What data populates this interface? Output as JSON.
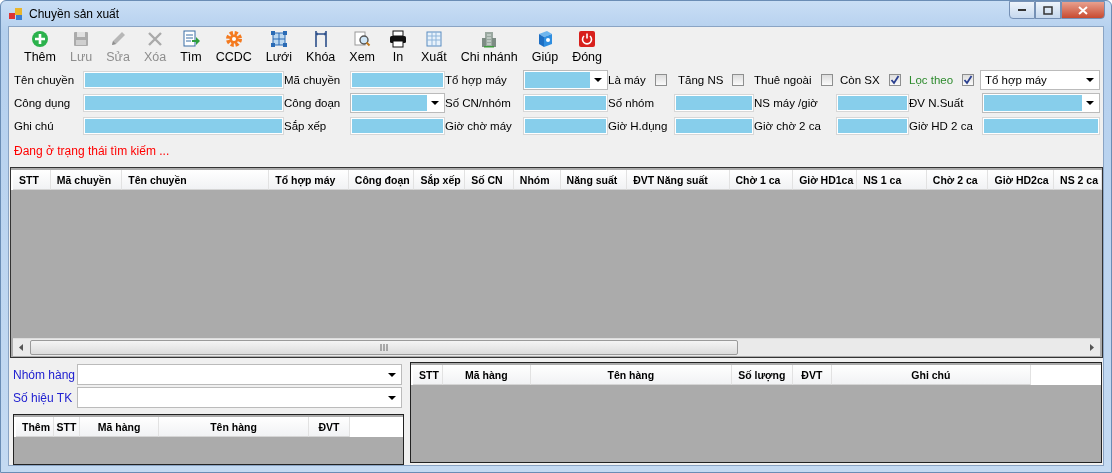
{
  "window": {
    "title": "Chuyền sản xuất"
  },
  "toolbar": [
    {
      "label": "Thêm",
      "disabled": false
    },
    {
      "label": "Lưu",
      "disabled": true
    },
    {
      "label": "Sửa",
      "disabled": true
    },
    {
      "label": "Xóa",
      "disabled": true
    },
    {
      "label": "Tìm",
      "disabled": false
    },
    {
      "label": "CCDC",
      "disabled": false
    },
    {
      "label": "Lưới",
      "disabled": false
    },
    {
      "label": "Khóa",
      "disabled": false
    },
    {
      "label": "Xem",
      "disabled": false
    },
    {
      "label": "In",
      "disabled": false
    },
    {
      "label": "Xuất",
      "disabled": false
    },
    {
      "label": "Chi nhánh",
      "disabled": false
    },
    {
      "label": "Giúp",
      "disabled": false
    },
    {
      "label": "Đóng",
      "disabled": false
    }
  ],
  "form": {
    "rows": [
      [
        {
          "kind": "label",
          "text": "Tên chuyền"
        },
        {
          "kind": "text"
        },
        {
          "kind": "label",
          "text": "Mã chuyền"
        },
        {
          "kind": "text"
        },
        {
          "kind": "label",
          "text": "Tổ hợp máy"
        },
        {
          "kind": "combo"
        },
        {
          "kind": "checkbox",
          "label": "Là máy",
          "checked": false
        },
        {
          "kind": "checkbox",
          "label": "Tăng NS",
          "checked": false
        },
        {
          "kind": "checkbox",
          "label": "Thuê ngoài",
          "checked": false
        },
        {
          "kind": "checkbox",
          "label": "Còn SX",
          "checked": true
        },
        {
          "kind": "filter-checkbox",
          "label": "Lọc theo",
          "checked": true
        },
        {
          "kind": "combo",
          "value": "Tổ hợp máy"
        }
      ],
      [
        {
          "kind": "label",
          "text": "Công dụng"
        },
        {
          "kind": "text"
        },
        {
          "kind": "label",
          "text": "Công đoạn"
        },
        {
          "kind": "combo"
        },
        {
          "kind": "label",
          "text": "Số CN/nhóm"
        },
        {
          "kind": "text"
        },
        {
          "kind": "label",
          "text": "Số nhóm"
        },
        {
          "kind": "text"
        },
        {
          "kind": "label",
          "text": "NS máy /giờ"
        },
        {
          "kind": "text"
        },
        {
          "kind": "label",
          "text": "ĐV N.Suất"
        },
        {
          "kind": "combo"
        }
      ],
      [
        {
          "kind": "label",
          "text": "Ghi chú"
        },
        {
          "kind": "text"
        },
        {
          "kind": "label",
          "text": "Sắp xếp"
        },
        {
          "kind": "text"
        },
        {
          "kind": "label",
          "text": "Giờ chờ máy"
        },
        {
          "kind": "text"
        },
        {
          "kind": "label",
          "text": "Giờ H.dụng"
        },
        {
          "kind": "text"
        },
        {
          "kind": "label",
          "text": "Giờ chờ 2 ca"
        },
        {
          "kind": "text"
        },
        {
          "kind": "label",
          "text": "Giờ HD 2 ca"
        },
        {
          "kind": "text"
        }
      ]
    ]
  },
  "status": "Đang ở trạng thái tìm kiếm ...",
  "main_table": {
    "columns": [
      "STT",
      "Mã chuyền",
      "Tên chuyền",
      "Tổ hợp máy",
      "Công đoạn",
      "Sắp xếp",
      "Số CN",
      "Nhóm",
      "Năng suất",
      "ĐVT Năng suất",
      "Chờ 1 ca",
      "Giờ HD1ca",
      "NS 1 ca",
      "Chờ 2 ca",
      "Giờ HD2ca",
      "NS 2 ca"
    ]
  },
  "item_filter": {
    "fields": [
      {
        "label": "Nhóm hàng"
      },
      {
        "label": "Số hiệu TK"
      }
    ],
    "table": {
      "columns": [
        "Thêm",
        "STT",
        "Mã hàng",
        "Tên hàng",
        "ĐVT"
      ]
    }
  },
  "items_table": {
    "columns": [
      "STT",
      "Mã hàng",
      "Tên hàng",
      "Số lượng",
      "ĐVT",
      "Ghi chú"
    ]
  }
}
